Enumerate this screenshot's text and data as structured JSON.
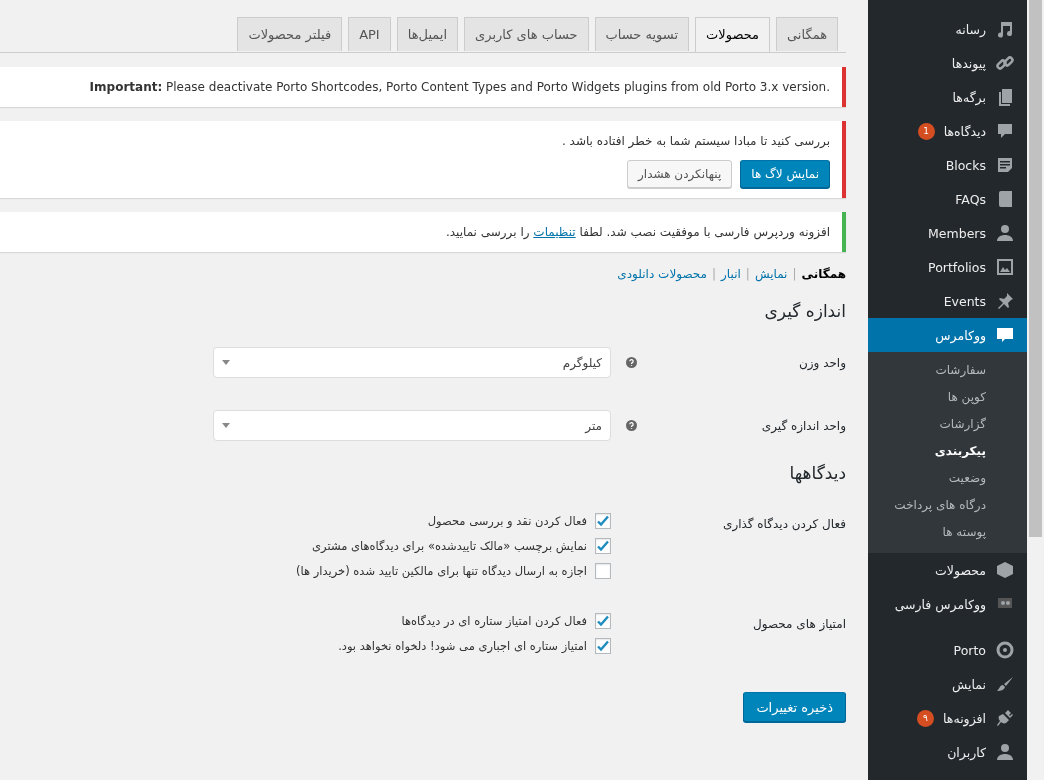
{
  "tabs": [
    {
      "label": "همگانی",
      "selected": false
    },
    {
      "label": "محصولات",
      "selected": true
    },
    {
      "label": "تسویه حساب",
      "selected": false
    },
    {
      "label": "حساب های کاربری",
      "selected": false
    },
    {
      "label": "ایمیل‌ها",
      "selected": false
    },
    {
      "label": "API",
      "selected": false
    },
    {
      "label": "فیلتر محصولات",
      "selected": false
    }
  ],
  "notices": [
    {
      "kind": "error",
      "text": "**Important:** Please deactivate Porto Shortcodes, Porto Content Types and Porto Widgets plugins from old Porto 3.x version."
    },
    {
      "kind": "error",
      "text": "بررسی کنید تا مبادا سیستم شما به خطر افتاده باشد .",
      "buttons": [
        {
          "label": "نمایش لاگ ها",
          "kind": "primary"
        },
        {
          "label": "پنهانکردن هشدار",
          "kind": "secondary"
        }
      ]
    },
    {
      "kind": "success",
      "text": "افزونه وردپرس فارسی با موفقیت نصب شد. لطفا",
      "link": "تنظیمات",
      "text_after": "را بررسی نمایید."
    }
  ],
  "subnav": {
    "separator": "|",
    "links": [
      {
        "label": "همگانی",
        "selected": true
      },
      {
        "label": "نمایش",
        "selected": false
      },
      {
        "label": "انبار",
        "selected": false
      },
      {
        "label": "محصولات دانلودی",
        "selected": false
      }
    ]
  },
  "sections": [
    {
      "title": "اندازه گیری",
      "fields": [
        {
          "kind": "select",
          "label": "واحد وزن",
          "value": "کیلوگرم"
        },
        {
          "kind": "select",
          "label": "واحد اندازه گیری",
          "value": "متر"
        }
      ]
    },
    {
      "title": "دیدگاهها",
      "fields": [
        {
          "kind": "checkboxes",
          "label": "فعال کردن دیدگاه گذاری",
          "options": [
            {
              "label": "فعال کردن نقد و بررسی محصول",
              "checked": true
            },
            {
              "label": "نمایش برچسب «مالک تاییدشده» برای دیدگاه‌های مشتری",
              "checked": true
            },
            {
              "label": "اجازه به ارسال دیدگاه تنها برای مالکین تایید شده (خریدار ها)",
              "checked": false
            }
          ]
        },
        {
          "kind": "checkboxes",
          "label": "امتیاز های محصول",
          "options": [
            {
              "label": "فعال کردن امتیاز ستاره ای در دیدگاه‌ها",
              "checked": true
            },
            {
              "label": "امتیاز ستاره ای اجباری می شود! دلخواه نخواهد بود.",
              "checked": true
            }
          ]
        }
      ]
    }
  ],
  "save_button": "ذخیره تغییرات",
  "sidebar": {
    "items": [
      {
        "label": "رسانه",
        "selected": false
      },
      {
        "label": "پیوندها",
        "selected": false
      },
      {
        "label": "برگه‌ها",
        "selected": false
      },
      {
        "label": "دیدگاه‌ها",
        "selected": false,
        "badge": "1"
      },
      {
        "label": "Blocks",
        "selected": false
      },
      {
        "label": "FAQs",
        "selected": false
      },
      {
        "label": "Members",
        "selected": false
      },
      {
        "label": "Portfolios",
        "selected": false
      },
      {
        "label": "Events",
        "selected": false
      },
      {
        "label": "ووکامرس",
        "selected": true,
        "submenu": [
          {
            "label": "سفارشات",
            "selected": false
          },
          {
            "label": "کوپن ها",
            "selected": false
          },
          {
            "label": "گزارشات",
            "selected": false
          },
          {
            "label": "پیکربندی",
            "selected": true
          },
          {
            "label": "وضعیت",
            "selected": false
          },
          {
            "label": "درگاه های پرداخت",
            "selected": false
          },
          {
            "label": "پوسته ها",
            "selected": false
          }
        ]
      },
      {
        "label": "محصولات",
        "selected": false
      },
      {
        "label": "ووکامرس فارسی",
        "selected": false
      },
      {
        "label": "Porto",
        "selected": false
      },
      {
        "label": "نمایش",
        "selected": false
      },
      {
        "label": "افزونه‌ها",
        "selected": false,
        "badge": "۹"
      },
      {
        "label": "کاربران",
        "selected": false
      }
    ]
  }
}
